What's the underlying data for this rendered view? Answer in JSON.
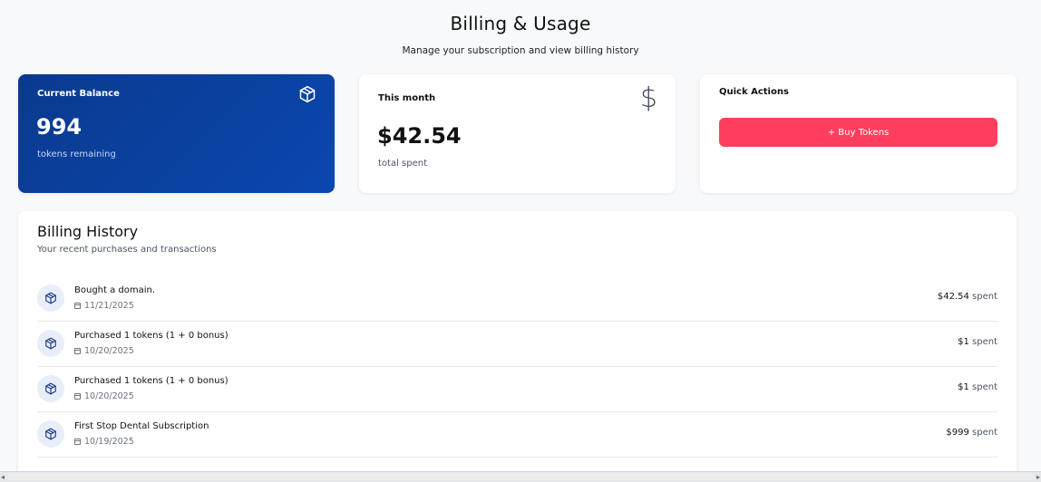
{
  "header": {
    "title": "Billing & Usage",
    "subtitle": "Manage your subscription and view billing history"
  },
  "balance_card": {
    "label": "Current Balance",
    "value": "994",
    "sub": "tokens remaining",
    "icon": "package-icon"
  },
  "month_card": {
    "label": "This month",
    "value": "$42.54",
    "sub": "total spent",
    "icon": "dollar-icon"
  },
  "actions_card": {
    "label": "Quick Actions",
    "buy_label": "+ Buy Tokens"
  },
  "history": {
    "title": "Billing History",
    "subtitle": "Your recent purchases and transactions",
    "items": [
      {
        "title": "Bought a domain.",
        "date": "11/21/2025",
        "amount": "$42.54",
        "unit": "spent"
      },
      {
        "title": "Purchased 1 tokens (1 + 0 bonus)",
        "date": "10/20/2025",
        "amount": "$1",
        "unit": "spent"
      },
      {
        "title": "Purchased 1 tokens (1 + 0 bonus)",
        "date": "10/20/2025",
        "amount": "$1",
        "unit": "spent"
      },
      {
        "title": "First Stop Dental Subscription",
        "date": "10/19/2025",
        "amount": "$999",
        "unit": "spent"
      }
    ]
  },
  "colors": {
    "balance_gradient_start": "#0a3a8e",
    "balance_gradient_end": "#0b47b0",
    "buy_button": "#ff3d5e",
    "row_icon_bg": "#e8eef9"
  }
}
